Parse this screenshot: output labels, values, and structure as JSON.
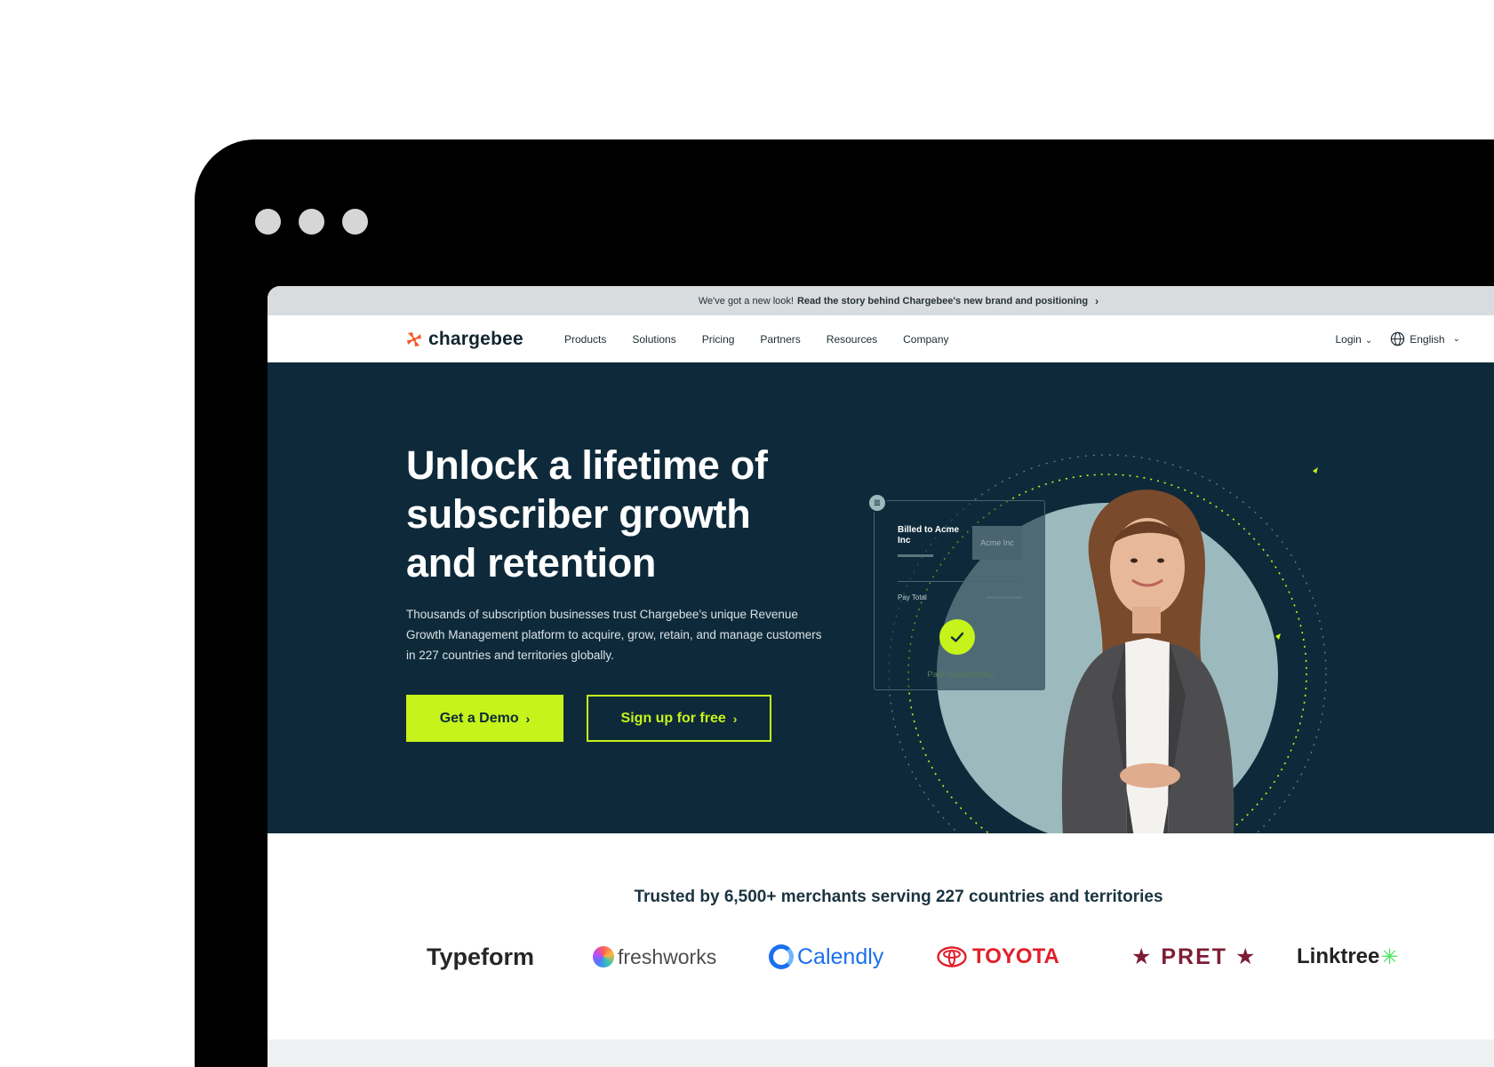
{
  "announcement": {
    "lead": "We've got a new look!",
    "link": "Read the story behind Chargebee's new brand and positioning",
    "chevron": "›"
  },
  "brand": {
    "name": "chargebee",
    "accent": "#f25a2b"
  },
  "menu": [
    "Products",
    "Solutions",
    "Pricing",
    "Partners",
    "Resources",
    "Company"
  ],
  "nav_right": {
    "login": "Login",
    "language": "English",
    "caret": "⌄"
  },
  "hero": {
    "title": "Unlock a lifetime of subscriber growth and retention",
    "description": "Thousands of subscription businesses trust Chargebee's unique Revenue Growth Management platform to acquire, grow, retain, and manage customers in 227 countries and territories globally.",
    "primary_cta": "Get a Demo",
    "secondary_cta": "Sign up for free",
    "cta_chevron": "›",
    "colors": {
      "background": "#0e2a3a",
      "accent": "#c6f31b",
      "circle": "#9cbabd"
    }
  },
  "invoice": {
    "billed_to": "Billed to Acme Inc",
    "acme_badge": "Acme Inc",
    "pay_total": "Pay Total",
    "status": "Paid Successfully"
  },
  "trusted": {
    "headline": "Trusted by 6,500+ merchants serving 227 countries and territories",
    "logos": {
      "typeform": "Typeform",
      "freshworks": "freshworks",
      "calendly": "Calendly",
      "toyota": "TOYOTA",
      "pret": "★ PRET ★",
      "linktree": "Linktree",
      "linktree_mark": "✳"
    }
  }
}
